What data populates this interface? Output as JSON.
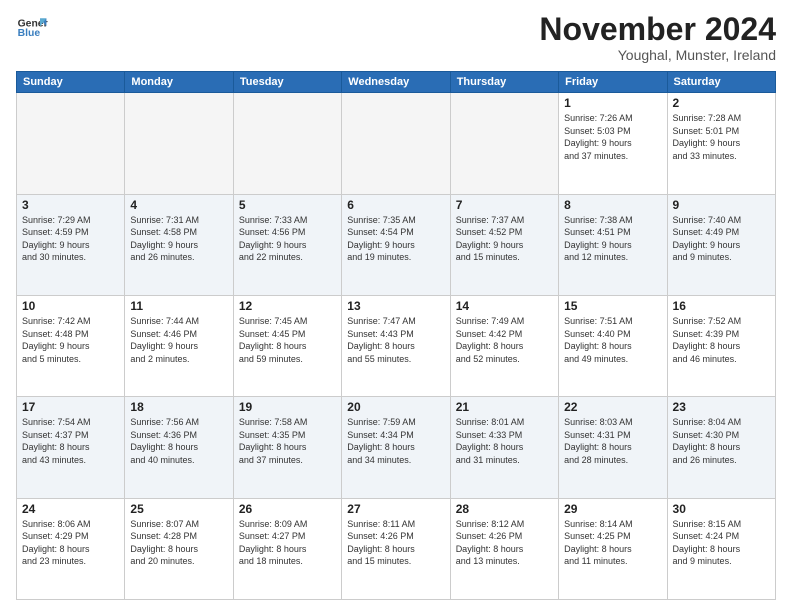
{
  "logo": {
    "line1": "General",
    "line2": "Blue"
  },
  "title": "November 2024",
  "subtitle": "Youghal, Munster, Ireland",
  "days_of_week": [
    "Sunday",
    "Monday",
    "Tuesday",
    "Wednesday",
    "Thursday",
    "Friday",
    "Saturday"
  ],
  "weeks": [
    [
      {
        "day": "",
        "info": ""
      },
      {
        "day": "",
        "info": ""
      },
      {
        "day": "",
        "info": ""
      },
      {
        "day": "",
        "info": ""
      },
      {
        "day": "",
        "info": ""
      },
      {
        "day": "1",
        "info": "Sunrise: 7:26 AM\nSunset: 5:03 PM\nDaylight: 9 hours\nand 37 minutes."
      },
      {
        "day": "2",
        "info": "Sunrise: 7:28 AM\nSunset: 5:01 PM\nDaylight: 9 hours\nand 33 minutes."
      }
    ],
    [
      {
        "day": "3",
        "info": "Sunrise: 7:29 AM\nSunset: 4:59 PM\nDaylight: 9 hours\nand 30 minutes."
      },
      {
        "day": "4",
        "info": "Sunrise: 7:31 AM\nSunset: 4:58 PM\nDaylight: 9 hours\nand 26 minutes."
      },
      {
        "day": "5",
        "info": "Sunrise: 7:33 AM\nSunset: 4:56 PM\nDaylight: 9 hours\nand 22 minutes."
      },
      {
        "day": "6",
        "info": "Sunrise: 7:35 AM\nSunset: 4:54 PM\nDaylight: 9 hours\nand 19 minutes."
      },
      {
        "day": "7",
        "info": "Sunrise: 7:37 AM\nSunset: 4:52 PM\nDaylight: 9 hours\nand 15 minutes."
      },
      {
        "day": "8",
        "info": "Sunrise: 7:38 AM\nSunset: 4:51 PM\nDaylight: 9 hours\nand 12 minutes."
      },
      {
        "day": "9",
        "info": "Sunrise: 7:40 AM\nSunset: 4:49 PM\nDaylight: 9 hours\nand 9 minutes."
      }
    ],
    [
      {
        "day": "10",
        "info": "Sunrise: 7:42 AM\nSunset: 4:48 PM\nDaylight: 9 hours\nand 5 minutes."
      },
      {
        "day": "11",
        "info": "Sunrise: 7:44 AM\nSunset: 4:46 PM\nDaylight: 9 hours\nand 2 minutes."
      },
      {
        "day": "12",
        "info": "Sunrise: 7:45 AM\nSunset: 4:45 PM\nDaylight: 8 hours\nand 59 minutes."
      },
      {
        "day": "13",
        "info": "Sunrise: 7:47 AM\nSunset: 4:43 PM\nDaylight: 8 hours\nand 55 minutes."
      },
      {
        "day": "14",
        "info": "Sunrise: 7:49 AM\nSunset: 4:42 PM\nDaylight: 8 hours\nand 52 minutes."
      },
      {
        "day": "15",
        "info": "Sunrise: 7:51 AM\nSunset: 4:40 PM\nDaylight: 8 hours\nand 49 minutes."
      },
      {
        "day": "16",
        "info": "Sunrise: 7:52 AM\nSunset: 4:39 PM\nDaylight: 8 hours\nand 46 minutes."
      }
    ],
    [
      {
        "day": "17",
        "info": "Sunrise: 7:54 AM\nSunset: 4:37 PM\nDaylight: 8 hours\nand 43 minutes."
      },
      {
        "day": "18",
        "info": "Sunrise: 7:56 AM\nSunset: 4:36 PM\nDaylight: 8 hours\nand 40 minutes."
      },
      {
        "day": "19",
        "info": "Sunrise: 7:58 AM\nSunset: 4:35 PM\nDaylight: 8 hours\nand 37 minutes."
      },
      {
        "day": "20",
        "info": "Sunrise: 7:59 AM\nSunset: 4:34 PM\nDaylight: 8 hours\nand 34 minutes."
      },
      {
        "day": "21",
        "info": "Sunrise: 8:01 AM\nSunset: 4:33 PM\nDaylight: 8 hours\nand 31 minutes."
      },
      {
        "day": "22",
        "info": "Sunrise: 8:03 AM\nSunset: 4:31 PM\nDaylight: 8 hours\nand 28 minutes."
      },
      {
        "day": "23",
        "info": "Sunrise: 8:04 AM\nSunset: 4:30 PM\nDaylight: 8 hours\nand 26 minutes."
      }
    ],
    [
      {
        "day": "24",
        "info": "Sunrise: 8:06 AM\nSunset: 4:29 PM\nDaylight: 8 hours\nand 23 minutes."
      },
      {
        "day": "25",
        "info": "Sunrise: 8:07 AM\nSunset: 4:28 PM\nDaylight: 8 hours\nand 20 minutes."
      },
      {
        "day": "26",
        "info": "Sunrise: 8:09 AM\nSunset: 4:27 PM\nDaylight: 8 hours\nand 18 minutes."
      },
      {
        "day": "27",
        "info": "Sunrise: 8:11 AM\nSunset: 4:26 PM\nDaylight: 8 hours\nand 15 minutes."
      },
      {
        "day": "28",
        "info": "Sunrise: 8:12 AM\nSunset: 4:26 PM\nDaylight: 8 hours\nand 13 minutes."
      },
      {
        "day": "29",
        "info": "Sunrise: 8:14 AM\nSunset: 4:25 PM\nDaylight: 8 hours\nand 11 minutes."
      },
      {
        "day": "30",
        "info": "Sunrise: 8:15 AM\nSunset: 4:24 PM\nDaylight: 8 hours\nand 9 minutes."
      }
    ]
  ]
}
